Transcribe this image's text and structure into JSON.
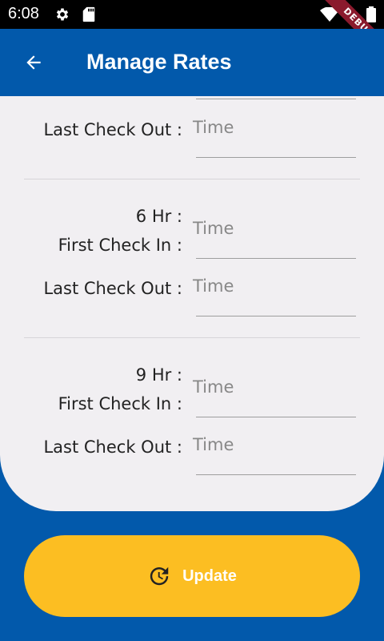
{
  "status_bar": {
    "time": "6:08"
  },
  "debug_banner": "DEBUG",
  "app_bar": {
    "title": "Manage Rates"
  },
  "fields": {
    "time_placeholder": "Time"
  },
  "labels": {
    "last_check_out": "Last Check Out :",
    "first_check_in": "First Check In :",
    "hr_6": "6 Hr :",
    "hr_9": "9 Hr :"
  },
  "update_button": {
    "label": "Update"
  },
  "colors": {
    "primary": "#0259AB",
    "accent": "#FCBE22",
    "card": "#F1EFF2"
  }
}
